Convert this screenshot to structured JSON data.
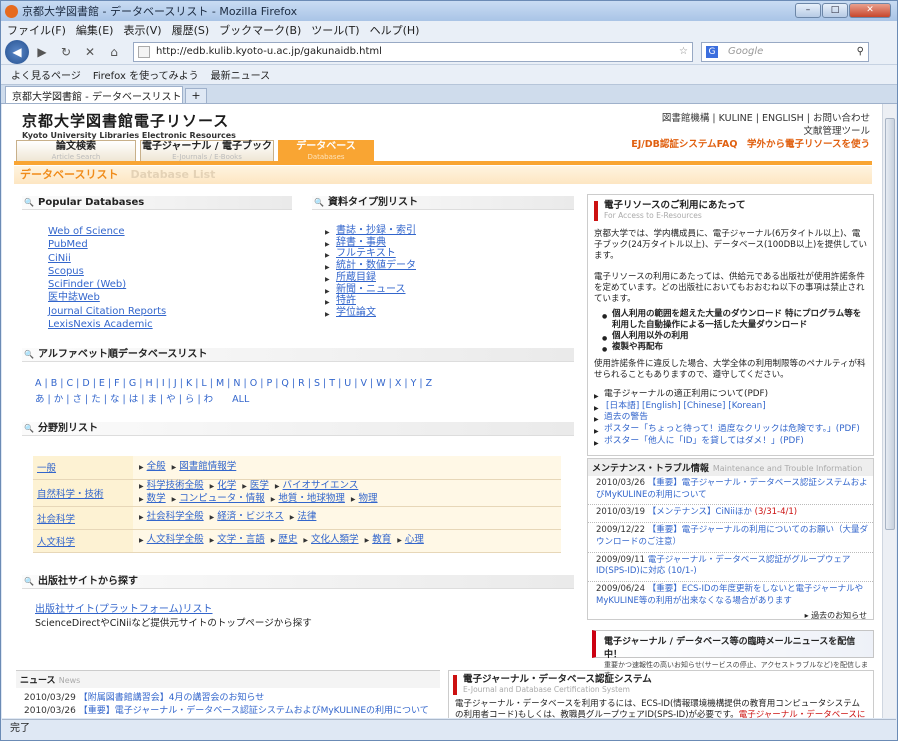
{
  "browser": {
    "window_title": "京都大学図書館 - データベースリスト - Mozilla Firefox",
    "menu": [
      "ファイル(F)",
      "編集(E)",
      "表示(V)",
      "履歴(S)",
      "ブックマーク(B)",
      "ツール(T)",
      "ヘルプ(H)"
    ],
    "url": "http://edb.kulib.kyoto-u.ac.jp/gakunaidb.html",
    "search_placeholder": "Google",
    "bookmarks": [
      "よく見るページ",
      "Firefox を使ってみよう",
      "最新ニュース"
    ],
    "tab_title": "京都大学図書館 - データベースリスト",
    "status": "完了"
  },
  "site": {
    "title_ja": "京都大学図書館電子リソース",
    "title_en": "Kyoto University Libraries Electronic Resources",
    "toplinks": "図書館機構 | KULINE | ENGLISH | お問い合わせ",
    "toolbar_link": "文献管理ツール",
    "faq": "EJ/DB認証システムFAQ",
    "offcampus": "学外から電子リソースを使う",
    "tabs": [
      {
        "ja": "論文検索",
        "en": "Article Search"
      },
      {
        "ja": "電子ジャーナル / 電子ブック",
        "en": "E-Journals / E-Books"
      },
      {
        "ja": "データベース",
        "en": "Databases"
      }
    ],
    "page_heading_ja": "データベースリスト",
    "page_heading_en": "Database List"
  },
  "popular": {
    "title": "Popular Databases",
    "items": [
      "Web of Science",
      "PubMed",
      "CiNii",
      "Scopus",
      "SciFinder (Web)",
      "医中誌Web",
      "Journal Citation Reports",
      "LexisNexis Academic"
    ]
  },
  "types": {
    "title": "資料タイプ別リスト",
    "items": [
      "書誌・抄録・索引",
      "辞書・事典",
      "フルテキスト",
      "統計・数値データ",
      "所蔵目録",
      "新聞・ニュース",
      "特許",
      "学位論文"
    ]
  },
  "alpha": {
    "title": "アルファベット順データベースリスト",
    "latin": "A | B | C | D | E | F | G | H | I | J | K | L | M | N | O | P | Q | R | S | T | U | V | W | X | Y | Z",
    "kana": "あ | か | さ | た | な | は | ま | や | ら | わ　　ALL"
  },
  "field": {
    "title": "分野別リスト",
    "rows": [
      {
        "h": "一般",
        "v": [
          "全般",
          "図書館情報学"
        ]
      },
      {
        "h": "自然科学・技術",
        "v": [
          "科学技術全般",
          "化学",
          "医学",
          "バイオサイエンス",
          "数学",
          "コンピュータ・情報",
          "地質・地球物理",
          "物理"
        ]
      },
      {
        "h": "社会科学",
        "v": [
          "社会科学全般",
          "経済・ビジネス",
          "法律"
        ]
      },
      {
        "h": "人文科学",
        "v": [
          "人文科学全般",
          "文学・言語",
          "歴史",
          "文化人類学",
          "教育",
          "心理"
        ]
      }
    ]
  },
  "publisher": {
    "title": "出版社サイトから探す",
    "link": "出版社サイト(プラットフォーム)リスト",
    "desc": "ScienceDirectやCiNiiなど提供元サイトのトップページから探す"
  },
  "notice": {
    "title": "電子リソースのご利用にあたって",
    "subtitle": "For Access to E-Resources",
    "p1": "京都大学では、学内構成員に、電子ジャーナル(6万タイトル以上)、電子ブック(24万タイトル以上)、データベース(100DB以上)を提供しています。",
    "p2": "電子リソースの利用にあたっては、供給元である出版社が使用許諾条件を定めています。どの出版社においてもおおむね以下の事項は禁止されています。",
    "bullets": [
      "個人利用の範囲を超えた大量のダウンロード 特にプログラム等を利用した自動操作による一括した大量ダウンロード",
      "個人利用以外の利用",
      "複製や再配布"
    ],
    "p3": "使用許諾条件に違反した場合、大学全体の利用制限等のペナルティが科せられることもありますので、遵守してください。",
    "links": [
      "電子ジャーナルの適正利用について(PDF)",
      "[日本語] [English] [Chinese] [Korean]",
      "過去の警告",
      "ポスター「ちょっと待って！過度なクリックは危険です。」(PDF)",
      "ポスター「他人に「ID」を貸してはダメ！」(PDF)"
    ]
  },
  "maintenance": {
    "title": "メンテナンス・トラブル情報",
    "subtitle": "Maintenance and Trouble Information",
    "items": [
      {
        "date": "2010/03/26",
        "text": "【重要】電子ジャーナル・データベース認証システムおよびMyKULINEの利用について"
      },
      {
        "date": "2010/03/19",
        "text": "【メンテナンス】CiNiiほか",
        "extra": "(3/31-4/1)"
      },
      {
        "date": "2009/12/22",
        "text": "【重要】電子ジャーナルの利用についてのお願い（大量ダウンロードのご注意）"
      },
      {
        "date": "2009/09/11",
        "text": "電子ジャーナル・データベース認証がグループウェアID(SPS-ID)に対応 (10/1-)"
      },
      {
        "date": "2009/06/24",
        "text": "【重要】ECS-IDの年度更新をしないと電子ジャーナルやMyKULINE等の利用が出来なくなる場合があります"
      }
    ],
    "past": "過去のお知らせ"
  },
  "banner": {
    "title": "電子ジャーナル / データベース等の臨時メールニュースを配信中！",
    "sub": "重要かつ速報性の高いお知らせ(サービスの停止、アクセストラブルなど)を配信します"
  },
  "news": {
    "title": "ニュース",
    "title_en": "News",
    "items": [
      {
        "date": "2010/03/29",
        "text": "【附属図書館講習会】4月の講習会のお知らせ"
      },
      {
        "date": "2010/03/26",
        "text": "【重要】電子ジャーナル・データベース認証システムおよびMyKULINEの利用について"
      }
    ]
  },
  "cert": {
    "title": "電子ジャーナル・データベース認証システム",
    "subtitle": "E-Journal and Database Certification System",
    "text": "電子ジャーナル・データベースを利用するには、ECS-ID(情報環境機構提供の教育用コンピュータシステムの利用者コード)もしくは、教職員グループウェアID(SPS-ID)が必要です。",
    "red": "電子ジャーナル・データベースにアクセスする"
  }
}
